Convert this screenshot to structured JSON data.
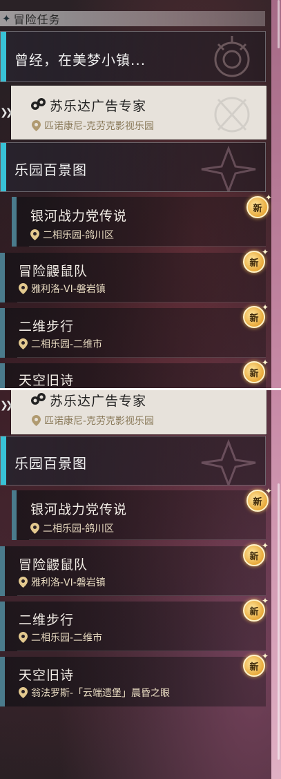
{
  "section_title": "冒险任务",
  "top_quest": {
    "title": "曾经，在美梦小镇..."
  },
  "selected_quest": {
    "title": "苏乐达广告专家",
    "location": "匹诺康尼-克劳克影视乐园"
  },
  "category": {
    "title": "乐园百景图"
  },
  "quests": [
    {
      "title": "银河战力党传说",
      "location": "二相乐园-鸽川区",
      "badge": "新"
    },
    {
      "title": "冒险鼹鼠队",
      "location": "雅利洛-VI-磐岩镇",
      "badge": "新"
    },
    {
      "title": "二维步行",
      "location": "二相乐园-二维市",
      "badge": "新"
    },
    {
      "title": "天空旧诗",
      "location": "翁法罗斯-「云端遗堡」晨昏之眼",
      "badge": "新"
    }
  ],
  "icons": {
    "section": "diamond-icon",
    "location": "map-pin-icon",
    "selected_arrow": "double-chevron-icon",
    "quest_type": "sodalite-quest-icon",
    "new_badge": "new-badge-icon"
  },
  "colors": {
    "accent_cyan": "#38c2d6",
    "gold": "#e8a93a",
    "selected_bg": "#e7e2db"
  }
}
